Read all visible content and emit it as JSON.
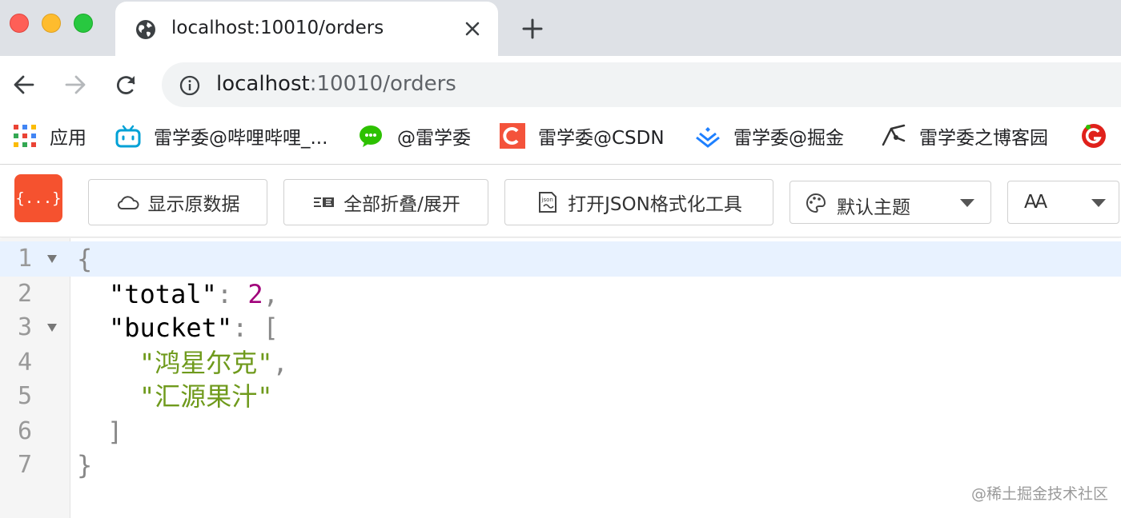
{
  "browser": {
    "tab": {
      "title": "localhost:10010/orders"
    },
    "address": {
      "host": "localhost",
      "rest": ":10010/orders"
    }
  },
  "bookmarks": [
    {
      "label": "应用",
      "icon": "apps-grid-icon"
    },
    {
      "label": "雷学委@哔哩哔哩_...",
      "icon": "bilibili-icon"
    },
    {
      "label": "@雷学委",
      "icon": "wechat-icon"
    },
    {
      "label": "雷学委@CSDN",
      "icon": "csdn-icon"
    },
    {
      "label": "雷学委@掘金",
      "icon": "juejin-icon"
    },
    {
      "label": "雷学委之博客园",
      "icon": "cnblogs-icon"
    }
  ],
  "viewer_toolbar": {
    "logo_text": "{...}",
    "raw_label": "显示原数据",
    "fold_label": "全部折叠/展开",
    "format_tool_label": "打开JSON格式化工具",
    "theme_label": "默认主题",
    "font_size_label": "AA"
  },
  "code_lines": [
    {
      "num": "1",
      "content": "{"
    },
    {
      "num": "2",
      "key": "\"total\"",
      "sep": ": ",
      "value": "2",
      "trail": ","
    },
    {
      "num": "3",
      "key": "\"bucket\"",
      "sep": ": ",
      "value": "["
    },
    {
      "num": "4",
      "value": "\"鸿星尔克\"",
      "trail": ","
    },
    {
      "num": "5",
      "value": "\"汇源果汁\""
    },
    {
      "num": "6",
      "value": "]"
    },
    {
      "num": "7",
      "content": "}"
    }
  ],
  "watermark": "@稀土掘金技术社区",
  "colors": {
    "tab_strip": "#dee1e6",
    "omnibox": "#f1f3f4",
    "logo": "#f5522f",
    "number": "#a0007a",
    "string": "#6f9a1c",
    "active_line": "#e8f2ff"
  }
}
